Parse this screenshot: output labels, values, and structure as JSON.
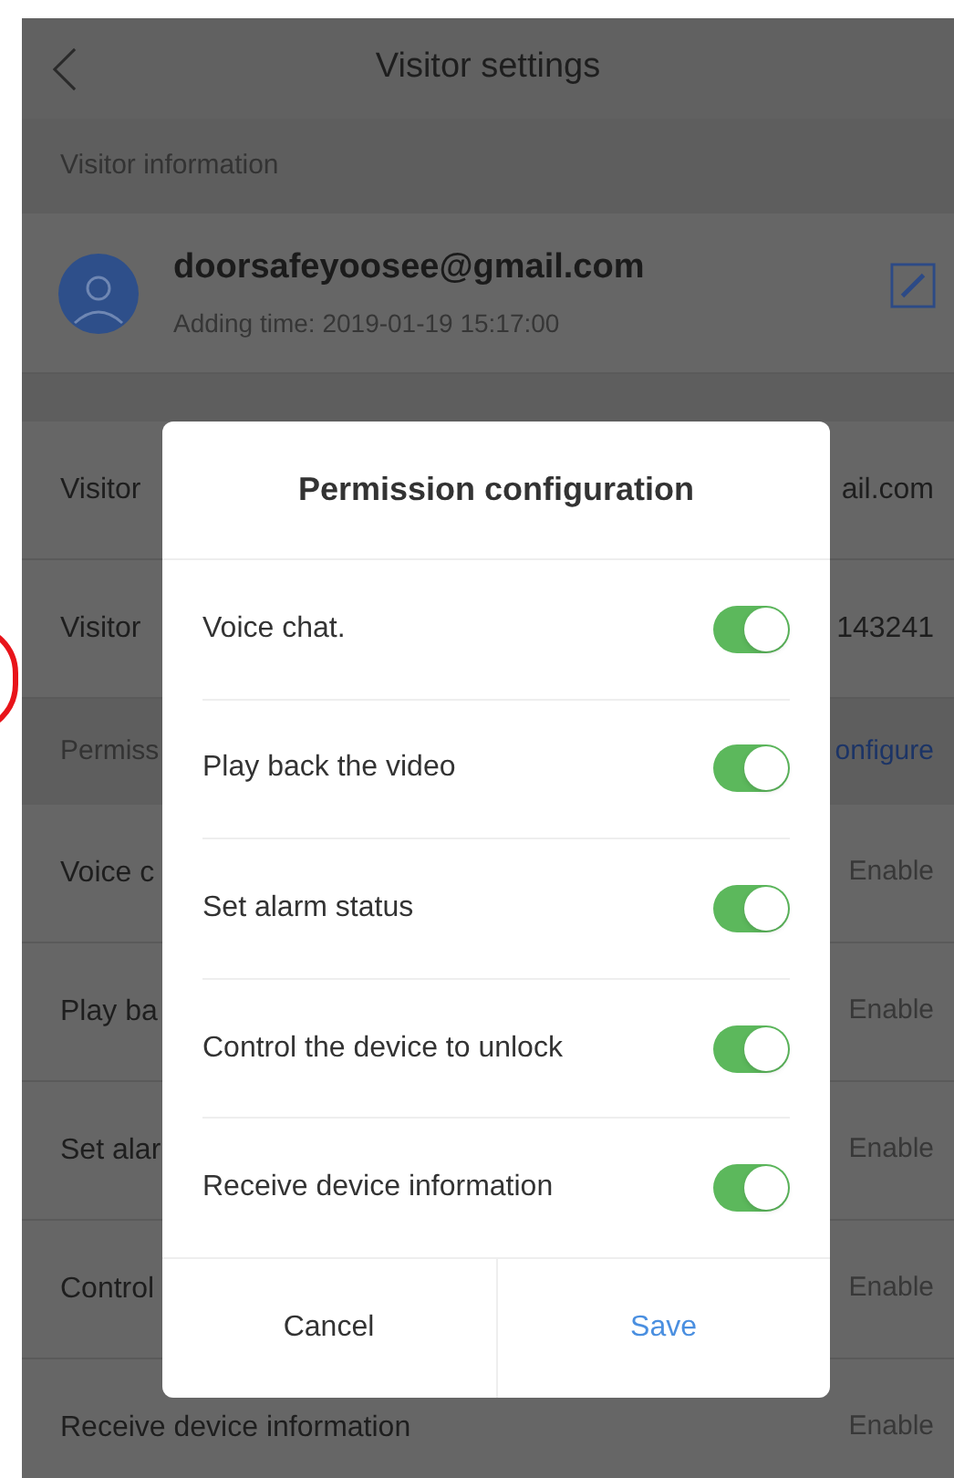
{
  "header": {
    "title": "Visitor settings"
  },
  "visitor_section": {
    "label": "Visitor information"
  },
  "visitor": {
    "email": "doorsafeyoosee@gmail.com",
    "adding_time": "Adding time: 2019-01-19 15:17:00"
  },
  "background_rows": [
    {
      "kind": "row",
      "label": "Visitor",
      "value": "ail.com"
    },
    {
      "kind": "row",
      "label": "Visitor",
      "value": "143241"
    },
    {
      "kind": "section",
      "label": "Permiss",
      "value": "onfigure"
    },
    {
      "kind": "row",
      "label": "Voice c",
      "value": "Enable"
    },
    {
      "kind": "row",
      "label": "Play ba",
      "value": "Enable"
    },
    {
      "kind": "row",
      "label": "Set alar",
      "value": "Enable"
    },
    {
      "kind": "row",
      "label": "Control",
      "value": "Enable"
    },
    {
      "kind": "row",
      "label": "Receive device information",
      "value": "Enable"
    }
  ],
  "dialog": {
    "title": "Permission configuration",
    "permissions": [
      {
        "label": "Voice chat.",
        "on": true
      },
      {
        "label": "Play back the video",
        "on": true
      },
      {
        "label": "Set alarm status",
        "on": true
      },
      {
        "label": "Control the device to unlock",
        "on": true
      },
      {
        "label": "Receive device information",
        "on": true
      }
    ],
    "buttons": [
      {
        "label": "Cancel",
        "kind": "cancel"
      },
      {
        "label": "Save",
        "kind": "primary"
      }
    ]
  }
}
